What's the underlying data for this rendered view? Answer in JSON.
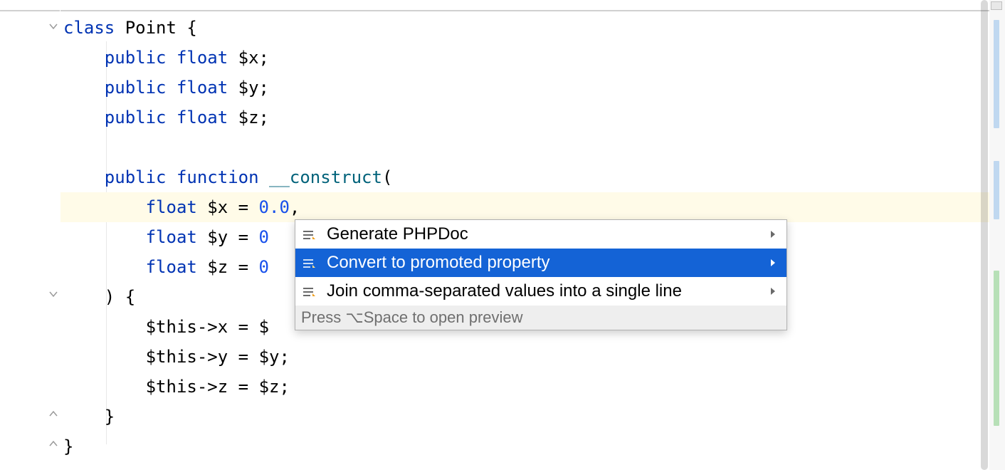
{
  "code": {
    "line1_kw": "class",
    "line1_name": " Point ",
    "line1_brace": "{",
    "line2_prefix": "    ",
    "line2_kw": "public float",
    "line2_var": " $x",
    "line2_end": ";",
    "line3_prefix": "    ",
    "line3_kw": "public float",
    "line3_var": " $y",
    "line3_end": ";",
    "line4_prefix": "    ",
    "line4_kw": "public float",
    "line4_var": " $z",
    "line4_end": ";",
    "line5": "",
    "line6_prefix": "    ",
    "line6_kw": "public function",
    "line6_space": " ",
    "line6_func": "__construct",
    "line6_paren": "(",
    "line7_prefix": "        ",
    "line7_kw": "float",
    "line7_var": " $x ",
    "line7_eq": "=",
    "line7_space": " ",
    "line7_val": "0.0",
    "line7_comma": ",",
    "line8_prefix": "        ",
    "line8_kw": "float",
    "line8_var": " $y ",
    "line8_eq": "=",
    "line8_space": " ",
    "line8_val": "0",
    "line9_prefix": "        ",
    "line9_kw": "float",
    "line9_var": " $z ",
    "line9_eq": "=",
    "line9_space": " ",
    "line9_val": "0",
    "line10_prefix": "    ",
    "line10_txt": ") {",
    "line11_prefix": "        ",
    "line11_this": "$this",
    "line11_arrow": "->",
    "line11_prop": "x",
    "line11_eq": " = ",
    "line11_val": "$",
    "line12_prefix": "        ",
    "line12_this": "$this",
    "line12_arrow": "->",
    "line12_prop": "y",
    "line12_eq": " = ",
    "line12_val": "$y",
    "line12_end": ";",
    "line13_prefix": "        ",
    "line13_this": "$this",
    "line13_arrow": "->",
    "line13_prop": "z",
    "line13_eq": " = ",
    "line13_val": "$z",
    "line13_end": ";",
    "line14_prefix": "    ",
    "line14_txt": "}",
    "line15_txt": "}"
  },
  "intention": {
    "items": [
      "Generate PHPDoc",
      "Convert to promoted property",
      "Join comma-separated values into a single line"
    ],
    "footer": "Press ⌥Space to open preview"
  }
}
